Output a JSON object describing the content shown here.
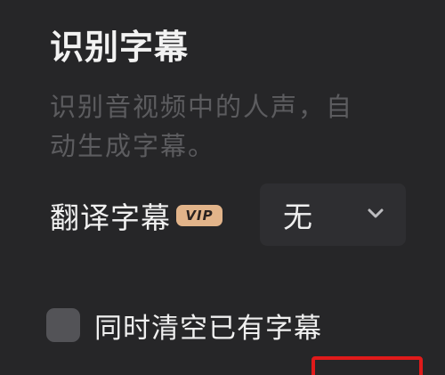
{
  "panel": {
    "title": "识别字幕",
    "description_line1": "识别音视频中的人声，自",
    "description_line2": "动生成字幕。"
  },
  "translate": {
    "label": "翻译字幕",
    "badge": "VIP",
    "selected": "无"
  },
  "options": {
    "clear_existing_label": "同时清空已有字幕",
    "clear_existing_checked": false
  },
  "colors": {
    "background": "#262628",
    "vip_badge": "#e2b48a",
    "highlight_border": "#e01a1a"
  },
  "icons": {
    "dropdown": "chevron-down-icon"
  }
}
